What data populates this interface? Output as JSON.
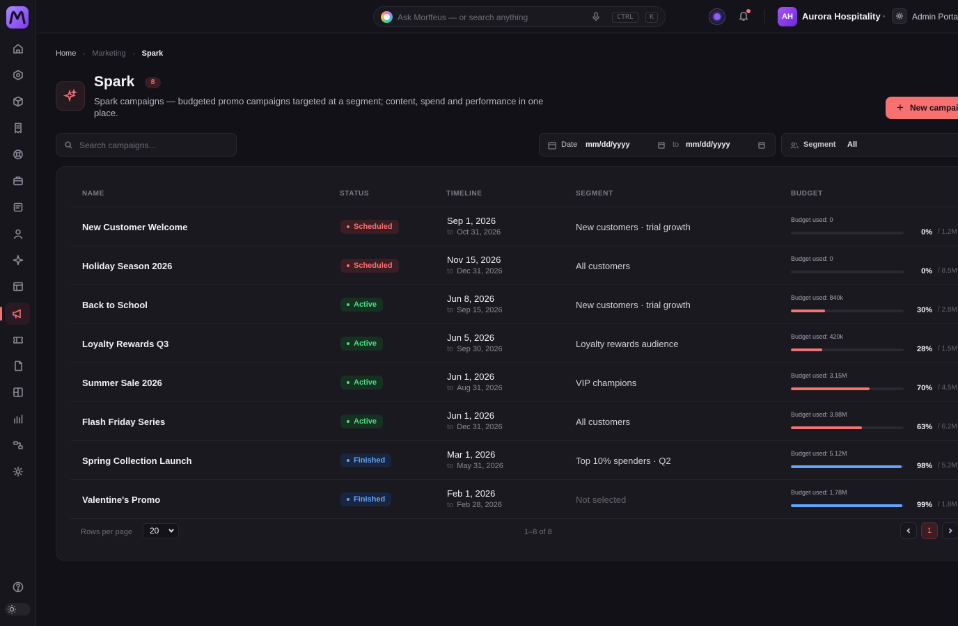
{
  "app": {
    "logo_icon": "morffeus-logo-icon"
  },
  "topbar": {
    "search_placeholder": "Ask Morffeus — or search anything",
    "kbd_ctrl": "CTRL",
    "kbd_k": "K",
    "avatar_initials": "AH",
    "org_name": "Aurora Hospitality",
    "portal_label": "Admin Portal"
  },
  "sidebar": {
    "items": [
      {
        "name": "home",
        "icon": "home-icon"
      },
      {
        "name": "hexagon",
        "icon": "hexagon-icon"
      },
      {
        "name": "products",
        "icon": "cube-icon"
      },
      {
        "name": "receipts",
        "icon": "receipt-icon"
      },
      {
        "name": "support",
        "icon": "lifebuoy-icon"
      },
      {
        "name": "inventory",
        "icon": "briefcase-icon"
      },
      {
        "name": "documents",
        "icon": "document-icon"
      },
      {
        "name": "customers",
        "icon": "user-icon"
      },
      {
        "name": "ai",
        "icon": "sparkle-icon"
      },
      {
        "name": "tables",
        "icon": "table-icon"
      },
      {
        "name": "marketing",
        "icon": "megaphone-icon",
        "active": true
      },
      {
        "name": "tickets",
        "icon": "ticket-icon"
      },
      {
        "name": "files",
        "icon": "file-icon"
      },
      {
        "name": "dashboards",
        "icon": "dashboard-icon"
      },
      {
        "name": "analytics",
        "icon": "bar-chart-icon"
      },
      {
        "name": "integrations",
        "icon": "integration-icon"
      },
      {
        "name": "settings",
        "icon": "gear-icon"
      }
    ],
    "help_icon": "help-circle-icon",
    "theme_icon": "sun-icon"
  },
  "breadcrumb": {
    "home": "Home",
    "section": "Marketing",
    "current": "Spark"
  },
  "page": {
    "icon": "sparkle-icon",
    "title": "Spark",
    "count": "8",
    "description": "Spark campaigns — budgeted promo campaigns targeted at a segment; content, spend and performance in one place.",
    "new_button": "New campaign"
  },
  "filters": {
    "search_placeholder": "Search campaigns...",
    "date_label": "Date",
    "date_from": "mm/dd/yyyy",
    "date_to_label": "to",
    "date_to": "mm/dd/yyyy",
    "segment_label": "Segment",
    "segment_value": "All"
  },
  "table": {
    "columns": {
      "name": "NAME",
      "status": "STATUS",
      "timeline": "TIMELINE",
      "segment": "SEGMENT",
      "budget": "BUDGET"
    },
    "to_label": "to",
    "rows": [
      {
        "name": "New Customer Welcome",
        "status": "Scheduled",
        "status_type": "scheduled",
        "start": "Sep 1, 2026",
        "end": "Oct 31, 2026",
        "segment": "New customers · trial growth",
        "budget_used": "Budget used: 0",
        "pct": 0,
        "pct_label": "0%",
        "total": "/ 1.2M",
        "bar_color": "#f87171"
      },
      {
        "name": "Holiday Season 2026",
        "status": "Scheduled",
        "status_type": "scheduled",
        "start": "Nov 15, 2026",
        "end": "Dec 31, 2026",
        "segment": "All customers",
        "budget_used": "Budget used: 0",
        "pct": 0,
        "pct_label": "0%",
        "total": "/ 8.5M",
        "bar_color": "#f87171"
      },
      {
        "name": "Back to School",
        "status": "Active",
        "status_type": "active",
        "start": "Jun 8, 2026",
        "end": "Sep 15, 2026",
        "segment": "New customers · trial growth",
        "budget_used": "Budget used: 840k",
        "pct": 30,
        "pct_label": "30%",
        "total": "/ 2.8M",
        "bar_color": "#f87171"
      },
      {
        "name": "Loyalty Rewards Q3",
        "status": "Active",
        "status_type": "active",
        "start": "Jun 5, 2026",
        "end": "Sep 30, 2026",
        "segment": "Loyalty rewards audience",
        "budget_used": "Budget used: 420k",
        "pct": 28,
        "pct_label": "28%",
        "total": "/ 1.5M",
        "bar_color": "#f87171"
      },
      {
        "name": "Summer Sale 2026",
        "status": "Active",
        "status_type": "active",
        "start": "Jun 1, 2026",
        "end": "Aug 31, 2026",
        "segment": "VIP champions",
        "budget_used": "Budget used: 3.15M",
        "pct": 70,
        "pct_label": "70%",
        "total": "/ 4.5M",
        "bar_color": "#f87171"
      },
      {
        "name": "Flash Friday Series",
        "status": "Active",
        "status_type": "active",
        "start": "Jun 1, 2026",
        "end": "Dec 31, 2026",
        "segment": "All customers",
        "budget_used": "Budget used: 3.88M",
        "pct": 63,
        "pct_label": "63%",
        "total": "/ 6.2M",
        "bar_color": "#f87171"
      },
      {
        "name": "Spring Collection Launch",
        "status": "Finished",
        "status_type": "finished",
        "start": "Mar 1, 2026",
        "end": "May 31, 2026",
        "segment": "Top 10% spenders · Q2",
        "budget_used": "Budget used: 5.12M",
        "pct": 98,
        "pct_label": "98%",
        "total": "/ 5.2M",
        "bar_color": "#60a5fa"
      },
      {
        "name": "Valentine's Promo",
        "status": "Finished",
        "status_type": "finished",
        "start": "Feb 1, 2026",
        "end": "Feb 28, 2026",
        "segment": "Not selected",
        "segment_muted": true,
        "budget_used": "Budget used: 1.78M",
        "pct": 99,
        "pct_label": "99%",
        "total": "/ 1.8M",
        "bar_color": "#60a5fa"
      }
    ]
  },
  "pagination": {
    "rows_per_page_label": "Rows per page",
    "rows_per_page": "20",
    "range": "1–8 of 8",
    "current_page": "1"
  },
  "colors": {
    "accent": "#f87171",
    "active": "#4ade80",
    "finished": "#60a5fa",
    "brand": "#8b5cf6"
  }
}
